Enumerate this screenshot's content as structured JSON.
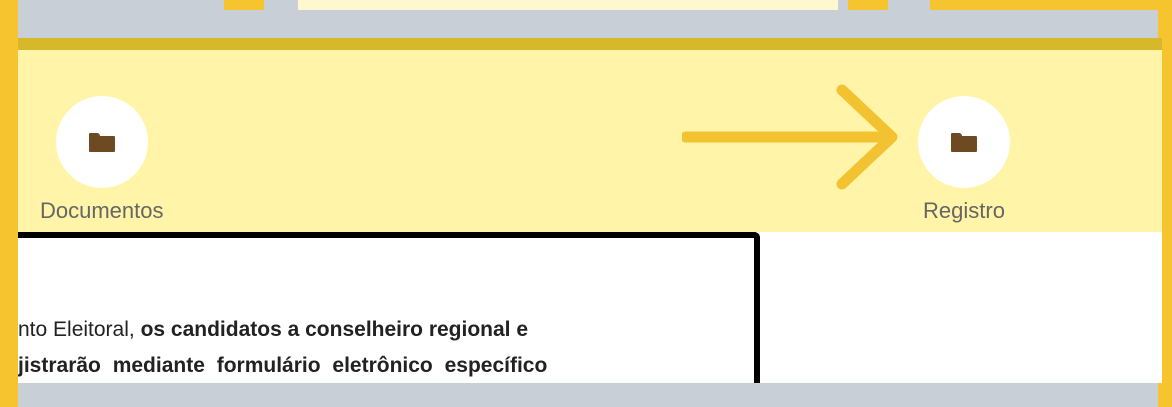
{
  "nav": {
    "items": [
      {
        "label": "Documentos",
        "icon": "folder-icon"
      },
      {
        "label": "Registro",
        "icon": "folder-icon"
      }
    ]
  },
  "document": {
    "line1_regular": "nto Eleitoral, ",
    "line1_bold": "os candidatos a conselheiro regional e",
    "line2_bold": "jistrarão mediante formulário eletrônico específico"
  },
  "colors": {
    "frame_yellow": "#f5c42f",
    "nav_band": "#fff4a7",
    "top_bar": "#d6b82a",
    "arrow": "#f2c230",
    "folder": "#6e4a22"
  }
}
